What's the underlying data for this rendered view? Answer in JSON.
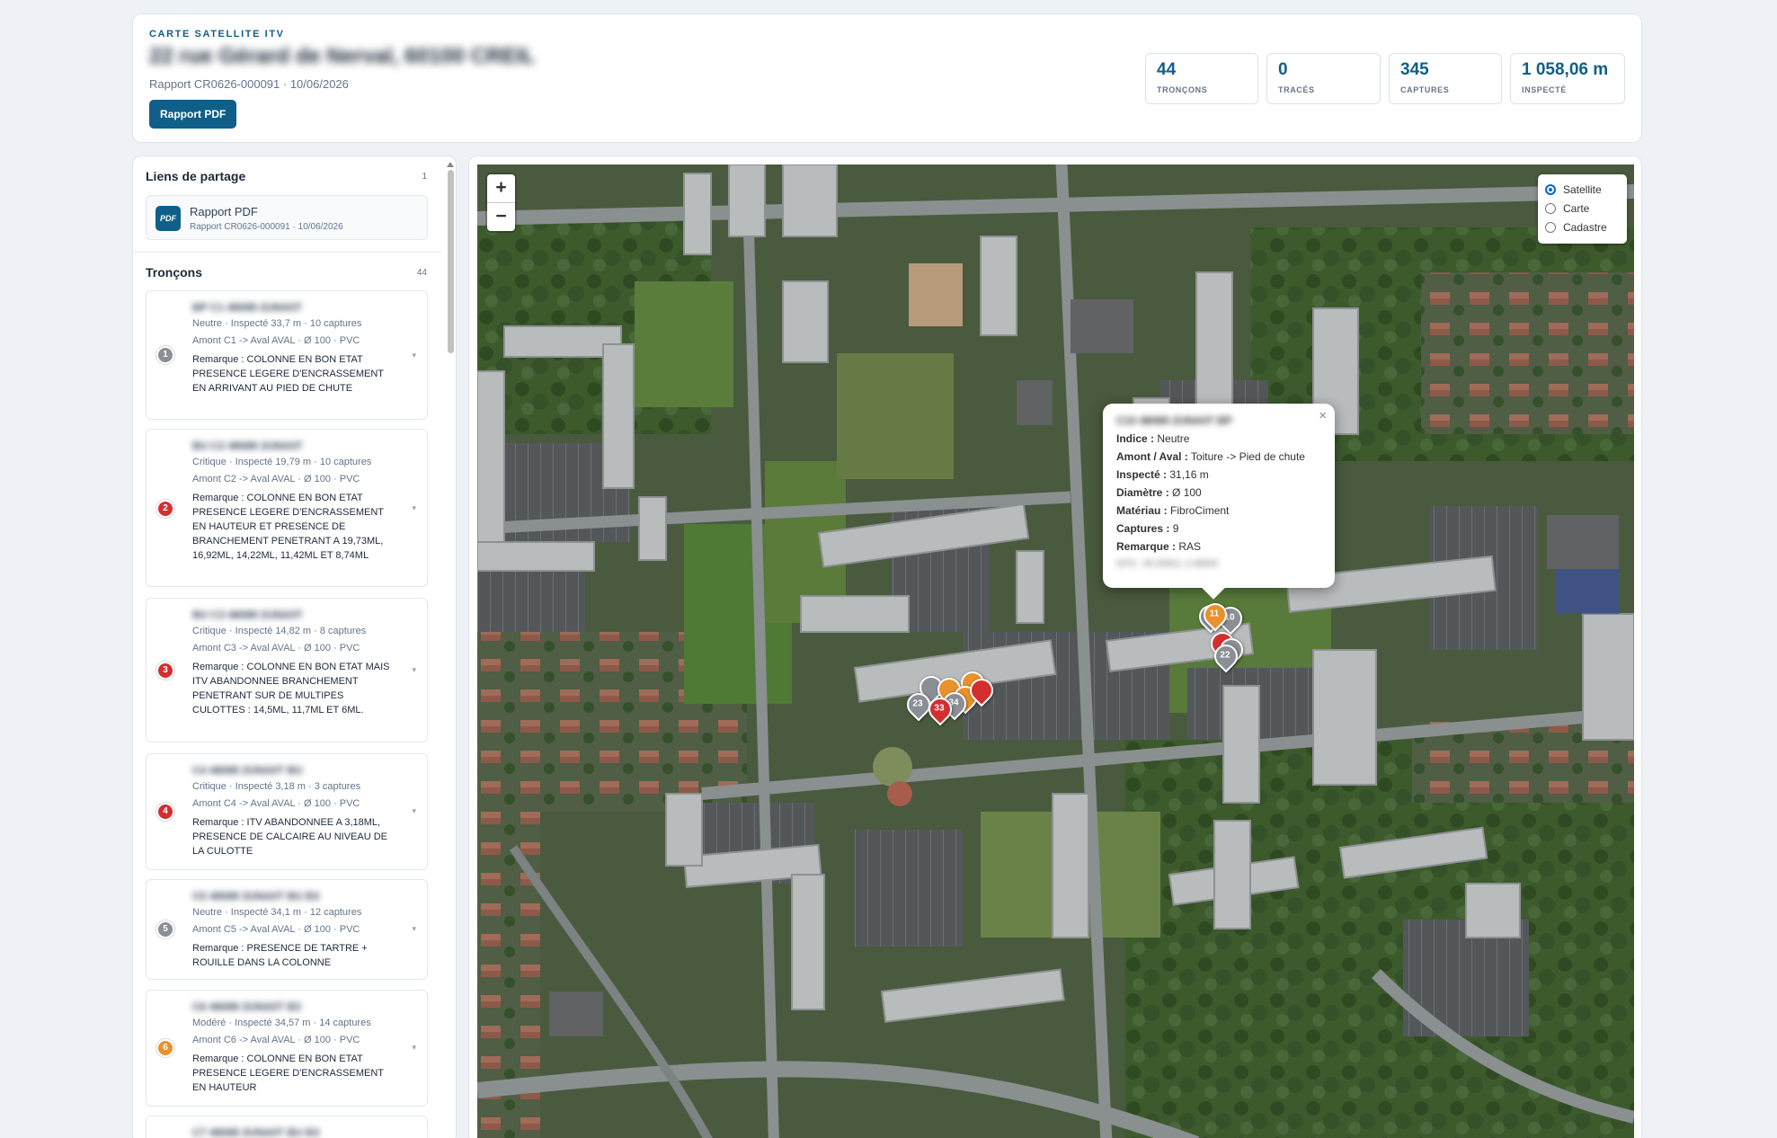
{
  "header": {
    "eyebrow": "CARTE SATELLITE ITV",
    "address": "22 rue Gérard de Nerval, 60100 CREIL",
    "report_line": "Rapport CR0626-000091 · 10/06/2026",
    "pdf_button": "Rapport PDF"
  },
  "stats": [
    {
      "value": "44",
      "label": "TRONÇONS"
    },
    {
      "value": "0",
      "label": "TRACÉS"
    },
    {
      "value": "345",
      "label": "CAPTURES"
    },
    {
      "value": "1 058,06 m",
      "label": "INSPECTÉ"
    }
  ],
  "sidebar": {
    "share_title": "Liens de partage",
    "share_count": "1",
    "share_item": {
      "badge": "PDF",
      "title": "Rapport PDF",
      "subtitle": "Rapport CR0626-000091 · 10/06/2026"
    },
    "segments_title": "Tronçons",
    "segments_count": "44",
    "segments": [
      {
        "num": "1",
        "color": "#8a8f96",
        "name": "BP C1 48089 2UNA0T",
        "meta1": "Neutre · Inspecté 33,7 m · 10 captures",
        "meta2": "Amont C1 -> Aval AVAL · Ø 100 · PVC",
        "remark_label": "Remarque :",
        "remark": "COLONNE EN BON ETAT PRESENCE LEGERE D'ENCRASSEMENT EN ARRIVANT AU PIED DE CHUTE"
      },
      {
        "num": "2",
        "color": "#d32f2f",
        "name": "BU C2 48089 2UNA0T",
        "meta1": "Critique · Inspecté 19,79 m · 10 captures",
        "meta2": "Amont C2 -> Aval AVAL · Ø 100 · PVC",
        "remark_label": "Remarque :",
        "remark": "COLONNE EN BON ETAT PRESENCE LEGERE D'ENCRASSEMENT EN HAUTEUR ET PRESENCE DE BRANCHEMENT PENETRANT A 19,73ML, 16,92ML, 14,22ML, 11,42ML ET 8,74ML"
      },
      {
        "num": "3",
        "color": "#d32f2f",
        "name": "BU C3 48089 2UNA0T",
        "meta1": "Critique · Inspecté 14,82 m · 8 captures",
        "meta2": "Amont C3 -> Aval AVAL · Ø 100 · PVC",
        "remark_label": "Remarque :",
        "remark": "COLONNE EN BON ETAT MAIS ITV ABANDONNEE BRANCHEMENT PENETRANT SUR DE MULTIPES CULOTTES : 14,5ML, 11,7ML ET 6ML."
      },
      {
        "num": "4",
        "color": "#d32f2f",
        "name": "C4 48089 2UNA0T BU",
        "meta1": "Critique · Inspecté 3,18 m · 3 captures",
        "meta2": "Amont C4 -> Aval AVAL · Ø 100 · PVC",
        "remark_label": "Remarque :",
        "remark": "ITV ABANDONNEE A 3,18ML, PRESENCE DE CALCAIRE AU NIVEAU DE LA CULOTTE"
      },
      {
        "num": "5",
        "color": "#8a8f96",
        "name": "C5 48089 2UNA0T BU B3",
        "meta1": "Neutre · Inspecté 34,1 m · 12 captures",
        "meta2": "Amont C5 -> Aval AVAL · Ø 100 · PVC",
        "remark_label": "Remarque :",
        "remark": "PRESENCE DE TARTRE + ROUILLE DANS LA COLONNE"
      },
      {
        "num": "6",
        "color": "#e8912d",
        "name": "C6 48089 2UNA0T B3",
        "meta1": "Modéré · Inspecté 34,57 m · 14 captures",
        "meta2": "Amont C6 -> Aval AVAL · Ø 100 · PVC",
        "remark_label": "Remarque :",
        "remark": "COLONNE EN BON ETAT PRESENCE LEGERE D'ENCRASSEMENT EN HAUTEUR"
      },
      {
        "num": "7",
        "color": "#8a8f96",
        "name": "C7 48089 2UNA0T BU B3",
        "meta1": "",
        "meta2": "",
        "remark_label": "",
        "remark": ""
      }
    ]
  },
  "map": {
    "zoom_in": "+",
    "zoom_out": "−",
    "layers": [
      {
        "label": "Satellite",
        "selected": true
      },
      {
        "label": "Carte",
        "selected": false
      },
      {
        "label": "Cadastre",
        "selected": false
      }
    ],
    "popup": {
      "close": "×",
      "title": "C10 48089 2UNA0T BP",
      "rows": [
        {
          "label": "Indice :",
          "value": "Neutre"
        },
        {
          "label": "Amont / Aval :",
          "value": "Toiture -> Pied de chute"
        },
        {
          "label": "Inspecté :",
          "value": "31,16 m"
        },
        {
          "label": "Diamètre :",
          "value": "Ø 100"
        },
        {
          "label": "Matériau :",
          "value": "FibroCiment"
        },
        {
          "label": "Captures :",
          "value": "9"
        },
        {
          "label": "Remarque :",
          "value": "RAS"
        }
      ],
      "footer": "GPS : 49.25822, 2.48093"
    },
    "pins": [
      {
        "num": "",
        "color": "#8a8f96"
      },
      {
        "num": "11",
        "color": "#e8912d"
      },
      {
        "num": "10",
        "color": "#8a8f96"
      },
      {
        "num": "",
        "color": "#d32f2f"
      },
      {
        "num": "",
        "color": "#8a8f96"
      },
      {
        "num": "22",
        "color": "#8a8f96"
      },
      {
        "num": "",
        "color": "#8a8f96"
      },
      {
        "num": "",
        "color": "#e8912d"
      },
      {
        "num": "",
        "color": "#e8912d"
      },
      {
        "num": "",
        "color": "#d32f2f"
      },
      {
        "num": "23",
        "color": "#8a8f96"
      },
      {
        "num": "34",
        "color": "#8a8f96"
      },
      {
        "num": "",
        "color": "#e8912d"
      },
      {
        "num": "33",
        "color": "#d32f2f"
      }
    ]
  }
}
